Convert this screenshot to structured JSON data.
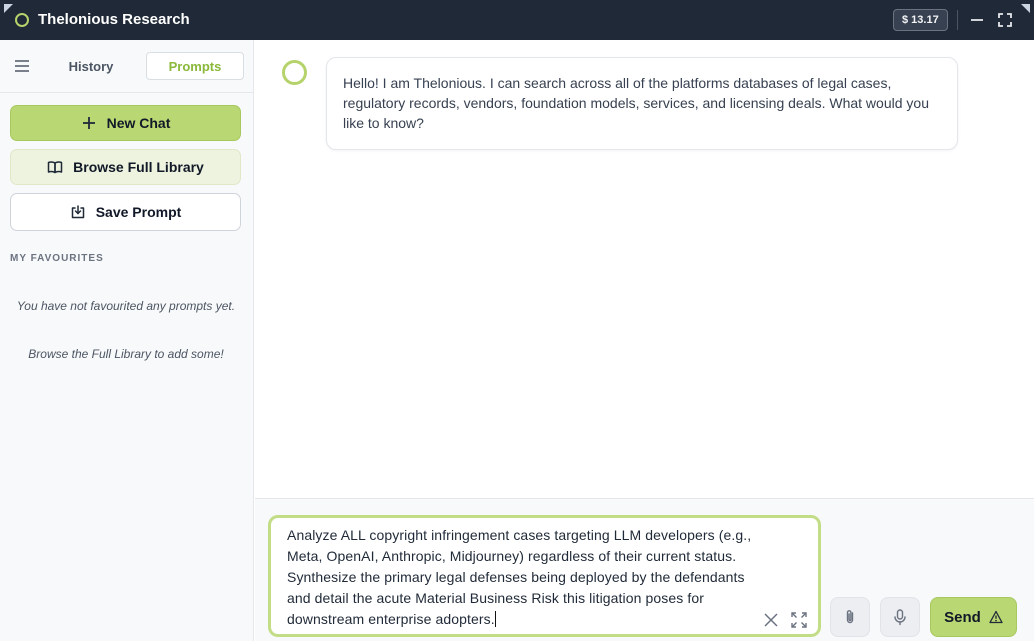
{
  "app": {
    "title": "Thelonious Research",
    "balance": "$ 13.17",
    "accent_color": "#b5d36a"
  },
  "sidebar": {
    "tabs": [
      {
        "label": "History",
        "active": false
      },
      {
        "label": "Prompts",
        "active": true
      }
    ],
    "new_chat_label": "New Chat",
    "browse_label": "Browse Full Library",
    "save_label": "Save Prompt",
    "favourites_heading": "MY FAVOURITES",
    "empty_line1": "You have not favourited any prompts yet.",
    "empty_line2": "Browse the Full Library to add some!"
  },
  "chat": {
    "messages": [
      {
        "role": "assistant",
        "text": "Hello! I am Thelonious. I can search across all of the platforms databases of legal cases, regulatory records, vendors, foundation models, services, and licensing deals. What would you like to know?"
      }
    ]
  },
  "composer": {
    "value": "Analyze ALL copyright infringement cases targeting LLM developers (e.g., Meta, OpenAI, Anthropic, Midjourney) regardless of their current status. Synthesize the primary legal defenses being deployed by the defendants and detail the acute Material Business Risk this litigation poses for downstream enterprise adopters.",
    "send_label": "Send"
  },
  "icons": [
    "logo-icon",
    "minimize-icon",
    "maximize-icon",
    "menu-icon",
    "plus-icon",
    "book-icon",
    "save-icon",
    "clear-icon",
    "expand-icon",
    "paperclip-icon",
    "microphone-icon",
    "warning-icon"
  ]
}
